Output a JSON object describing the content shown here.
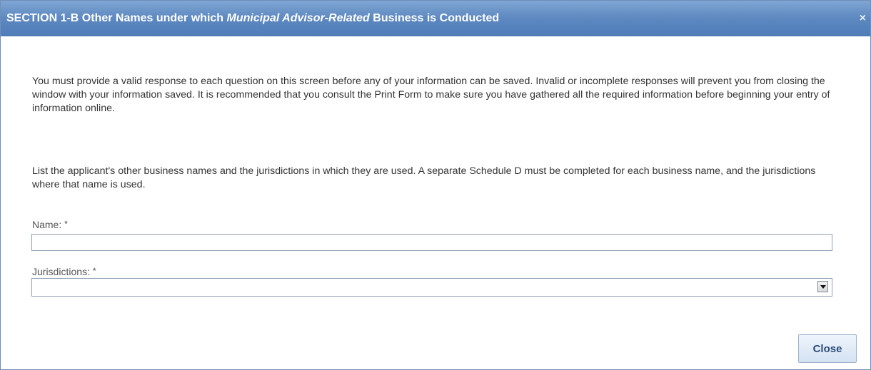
{
  "dialog": {
    "title_prefix": "SECTION 1-B Other Names under which ",
    "title_italic": "Municipal Advisor-Related",
    "title_suffix": " Business is Conducted",
    "close_glyph": "×"
  },
  "instructions": {
    "paragraph1": "You must provide a valid response to each question on this screen before any of your information can be saved. Invalid or incomplete responses will prevent you from closing the window with your information saved. It is recommended that you consult the Print Form to make sure you have gathered all the required information before beginning your entry of information online.",
    "paragraph2": "List the applicant's other business names and the jurisdictions in which they are used. A separate Schedule D must be completed for each business name, and the jurisdictions where that name is used."
  },
  "form": {
    "name_label": "Name:",
    "name_required": "*",
    "name_value": "",
    "jurisdictions_label": "Jurisdictions:",
    "jurisdictions_required": "*",
    "jurisdictions_value": ""
  },
  "footer": {
    "close_label": "Close"
  },
  "colors": {
    "titlebar": "#5d88c0",
    "close_button_text": "#2a4d7a"
  },
  "icons": {
    "dialog_close": "close-icon",
    "dropdown": "chevron-down-icon"
  }
}
